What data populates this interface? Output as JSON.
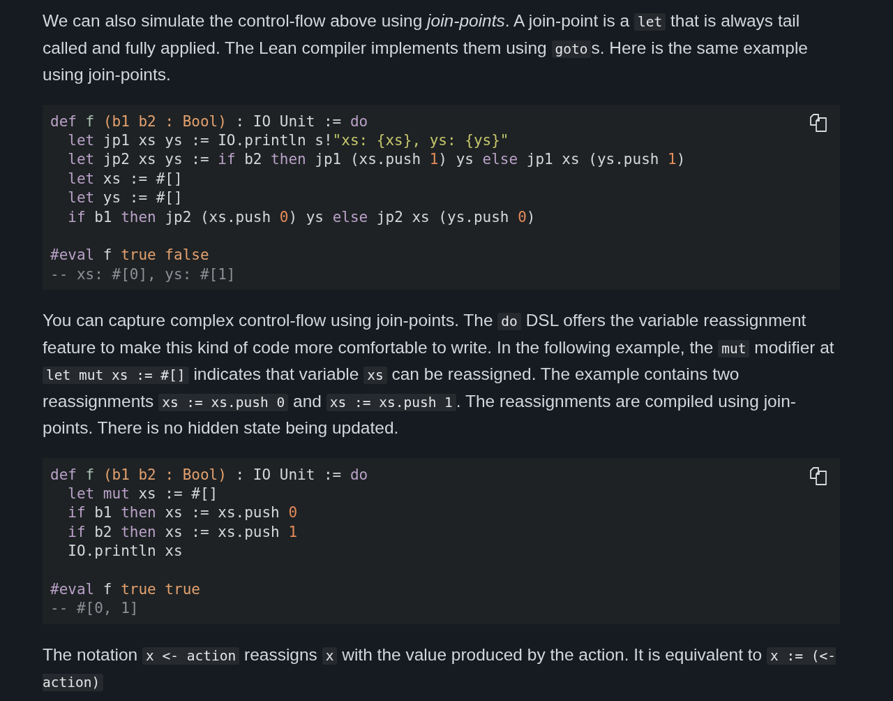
{
  "content": [
    {
      "kind": "paragraph",
      "segments": [
        {
          "kind": "text",
          "text": "We can also simulate the control-flow above using "
        },
        {
          "kind": "em",
          "text": "join-points"
        },
        {
          "kind": "text",
          "text": ". A join-point is a "
        },
        {
          "kind": "code",
          "text": "let"
        },
        {
          "kind": "text",
          "text": " that is always tail called and fully applied. The Lean compiler implements them using "
        },
        {
          "kind": "code",
          "text": "goto"
        },
        {
          "kind": "text",
          "text": "s. Here is the same example using join-points."
        }
      ]
    },
    {
      "kind": "code",
      "sections": [
        [
          [
            {
              "kind": "keyword",
              "text": "def "
            },
            {
              "kind": "fn",
              "text": "f "
            },
            {
              "kind": "param",
              "text": "(b1 b2 : Bool)"
            },
            {
              "kind": "plain",
              "text": " : IO Unit := "
            },
            {
              "kind": "keyword",
              "text": "do"
            }
          ],
          [
            {
              "kind": "keyword",
              "text": "  let"
            },
            {
              "kind": "plain",
              "text": " jp1 xs ys := IO.println s!"
            },
            {
              "kind": "string",
              "text": "\"xs: {xs}, ys: {ys}\""
            }
          ],
          [
            {
              "kind": "keyword",
              "text": "  let"
            },
            {
              "kind": "plain",
              "text": " jp2 xs ys := "
            },
            {
              "kind": "keyword",
              "text": "if"
            },
            {
              "kind": "plain",
              "text": " b2 "
            },
            {
              "kind": "keyword",
              "text": "then"
            },
            {
              "kind": "plain",
              "text": " jp1 (xs.push "
            },
            {
              "kind": "number",
              "text": "1"
            },
            {
              "kind": "plain",
              "text": ") ys "
            },
            {
              "kind": "keyword",
              "text": "else"
            },
            {
              "kind": "plain",
              "text": " jp1 xs (ys.push "
            },
            {
              "kind": "number",
              "text": "1"
            },
            {
              "kind": "plain",
              "text": ")"
            }
          ],
          [
            {
              "kind": "keyword",
              "text": "  let"
            },
            {
              "kind": "plain",
              "text": " xs := #[]"
            }
          ],
          [
            {
              "kind": "keyword",
              "text": "  let"
            },
            {
              "kind": "plain",
              "text": " ys := #[]"
            }
          ],
          [
            {
              "kind": "keyword",
              "text": "  if"
            },
            {
              "kind": "plain",
              "text": " b1 "
            },
            {
              "kind": "keyword",
              "text": "then"
            },
            {
              "kind": "plain",
              "text": " jp2 (xs.push "
            },
            {
              "kind": "number",
              "text": "0"
            },
            {
              "kind": "plain",
              "text": ") ys "
            },
            {
              "kind": "keyword",
              "text": "else"
            },
            {
              "kind": "plain",
              "text": " jp2 xs (ys.push "
            },
            {
              "kind": "number",
              "text": "0"
            },
            {
              "kind": "plain",
              "text": ")"
            }
          ]
        ],
        [
          [
            {
              "kind": "keyword",
              "text": "#eval"
            },
            {
              "kind": "plain",
              "text": " f "
            },
            {
              "kind": "param",
              "text": "true false"
            }
          ],
          [
            {
              "kind": "comment",
              "text": "-- xs: #[0], ys: #[1]"
            }
          ]
        ]
      ]
    },
    {
      "kind": "paragraph",
      "segments": [
        {
          "kind": "text",
          "text": "You can capture complex control-flow using join-points. The "
        },
        {
          "kind": "code",
          "text": "do"
        },
        {
          "kind": "text",
          "text": " DSL offers the variable reassignment feature to make this kind of code more comfortable to write. In the following example, the "
        },
        {
          "kind": "code",
          "text": "mut"
        },
        {
          "kind": "text",
          "text": " modifier at "
        },
        {
          "kind": "code",
          "text": "let mut xs := #[]"
        },
        {
          "kind": "text",
          "text": " indicates that variable "
        },
        {
          "kind": "code",
          "text": "xs"
        },
        {
          "kind": "text",
          "text": " can be reassigned. The example contains two reassignments "
        },
        {
          "kind": "code",
          "text": "xs := xs.push 0"
        },
        {
          "kind": "text",
          "text": " and "
        },
        {
          "kind": "code",
          "text": "xs := xs.push 1"
        },
        {
          "kind": "text",
          "text": ". The reassignments are compiled using join-points. There is no hidden state being updated."
        }
      ]
    },
    {
      "kind": "code",
      "sections": [
        [
          [
            {
              "kind": "keyword",
              "text": "def "
            },
            {
              "kind": "fn",
              "text": "f "
            },
            {
              "kind": "param",
              "text": "(b1 b2 : Bool)"
            },
            {
              "kind": "plain",
              "text": " : IO Unit := "
            },
            {
              "kind": "keyword",
              "text": "do"
            }
          ],
          [
            {
              "kind": "keyword",
              "text": "  let mut"
            },
            {
              "kind": "plain",
              "text": " xs := #[]"
            }
          ],
          [
            {
              "kind": "keyword",
              "text": "  if"
            },
            {
              "kind": "plain",
              "text": " b1 "
            },
            {
              "kind": "keyword",
              "text": "then"
            },
            {
              "kind": "plain",
              "text": " xs := xs.push "
            },
            {
              "kind": "number",
              "text": "0"
            }
          ],
          [
            {
              "kind": "keyword",
              "text": "  if"
            },
            {
              "kind": "plain",
              "text": " b2 "
            },
            {
              "kind": "keyword",
              "text": "then"
            },
            {
              "kind": "plain",
              "text": " xs := xs.push "
            },
            {
              "kind": "number",
              "text": "1"
            }
          ],
          [
            {
              "kind": "plain",
              "text": "  IO.println xs"
            }
          ]
        ],
        [
          [
            {
              "kind": "keyword",
              "text": "#eval"
            },
            {
              "kind": "plain",
              "text": " f "
            },
            {
              "kind": "param",
              "text": "true true"
            }
          ],
          [
            {
              "kind": "comment",
              "text": "-- #[0, 1]"
            }
          ]
        ]
      ]
    },
    {
      "kind": "paragraph",
      "segments": [
        {
          "kind": "text",
          "text": "The notation "
        },
        {
          "kind": "code",
          "text": "x <- action"
        },
        {
          "kind": "text",
          "text": " reassigns "
        },
        {
          "kind": "code",
          "text": "x"
        },
        {
          "kind": "text",
          "text": " with the value produced by the action. It is equivalent to "
        },
        {
          "kind": "code",
          "text": "x := (<- action)"
        }
      ]
    }
  ]
}
